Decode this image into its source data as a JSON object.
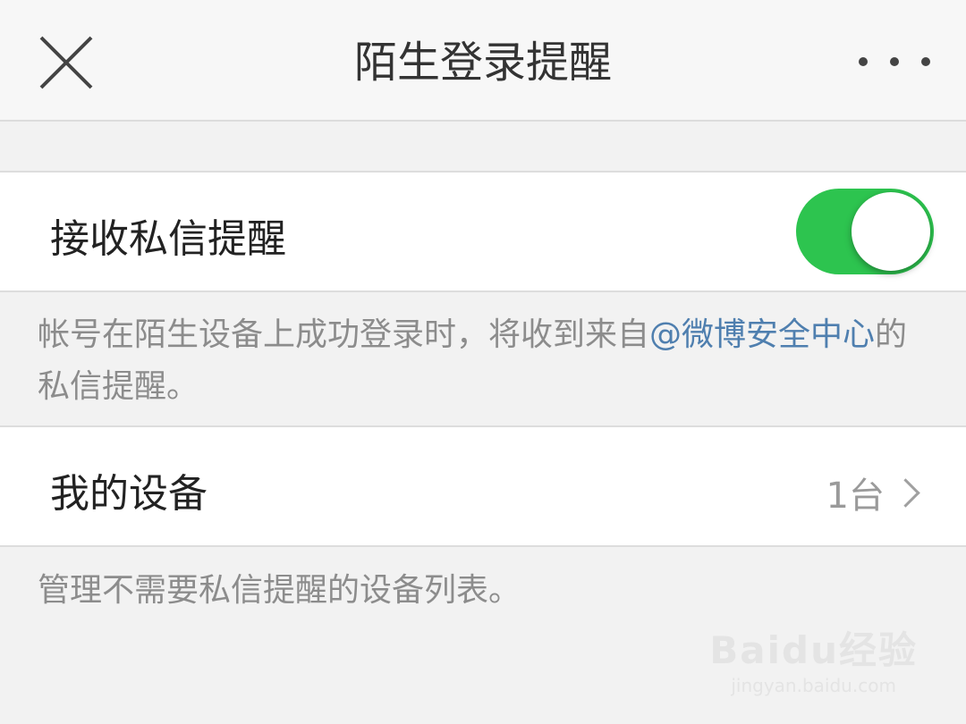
{
  "header": {
    "title": "陌生登录提醒",
    "close_icon": "close-icon",
    "more_icon": "more-dots-icon"
  },
  "settings": {
    "receive_pm": {
      "label": "接收私信提醒",
      "enabled": true,
      "accent_color": "#2dc44f"
    },
    "receive_pm_desc": {
      "prefix": "帐号在陌生设备上成功登录时，将收到来自",
      "link": "@微博安全中心",
      "suffix": "的私信提醒。"
    },
    "my_devices": {
      "label": "我的设备",
      "value": "1台",
      "chevron_icon": "chevron-right-icon"
    },
    "my_devices_desc": "管理不需要私信提醒的设备列表。"
  },
  "watermark": {
    "main": "Baidu经验",
    "sub": "jingyan.baidu.com"
  }
}
